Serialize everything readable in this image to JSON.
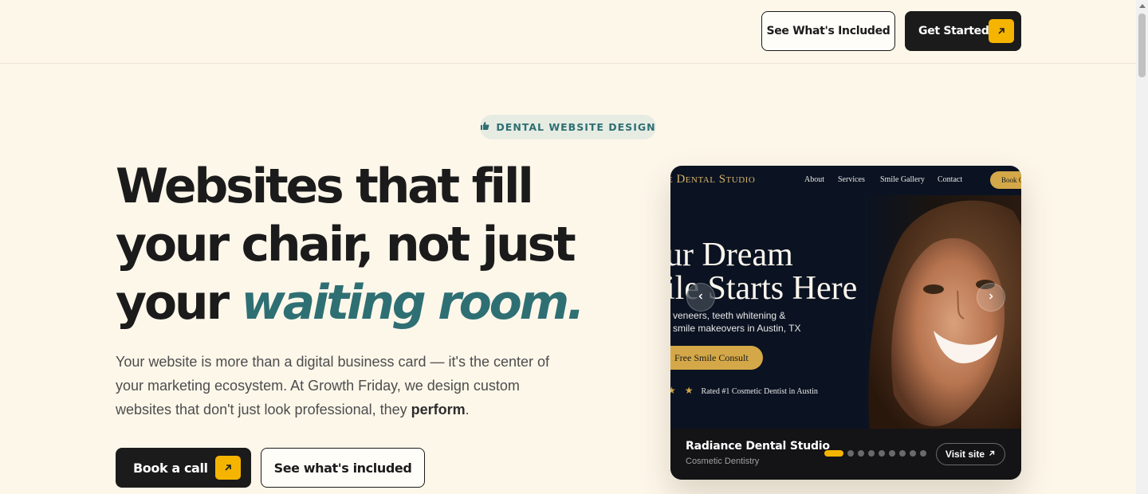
{
  "header": {
    "see_included_label": "See What's Included",
    "get_started_label": "Get Started"
  },
  "badge": {
    "icon": "thumbs-up-icon",
    "label": "DENTAL WEBSITE DESIGN"
  },
  "hero": {
    "headline_line1": "Websites that fill",
    "headline_line2": "your chair, not just",
    "headline_line3_plain": "your ",
    "headline_line3_accent": "waiting room.",
    "body_text": "Your website is more than a digital business card — it's the center of your marketing ecosystem. At Growth Friday, we design custom websites that don't just look professional, they ",
    "body_emphasis": "perform",
    "body_end": ".",
    "book_call_label": "Book a call",
    "see_included_label": "See what's included"
  },
  "preview": {
    "site": {
      "brand": "e Dental Studio",
      "nav": [
        "About",
        "Services",
        "Smile Gallery",
        "Contact"
      ],
      "book_label": "Book C",
      "headline_line1": "ur Dream",
      "headline_line2": "ile Starts Here",
      "subtext_line1": "veneers, teeth whitening &",
      "subtext_line2": "smile makeovers in Austin, TX",
      "cta": "Free Smile Consult",
      "stars": "★ ★",
      "rated": "Rated #1 Cosmetic Dentist in Austin"
    },
    "prev_icon": "chevron-left-icon",
    "next_icon": "chevron-right-icon",
    "footer": {
      "title": "Radiance Dental Studio",
      "subtitle": "Cosmetic Dentistry",
      "slide_count": 9,
      "active_slide": 1,
      "visit_label": "Visit site"
    }
  },
  "colors": {
    "background": "#fdf7ea",
    "ink": "#1b1b1b",
    "accent_teal": "#2e6f73",
    "accent_yellow": "#f4b400",
    "gold": "#d4a848"
  }
}
